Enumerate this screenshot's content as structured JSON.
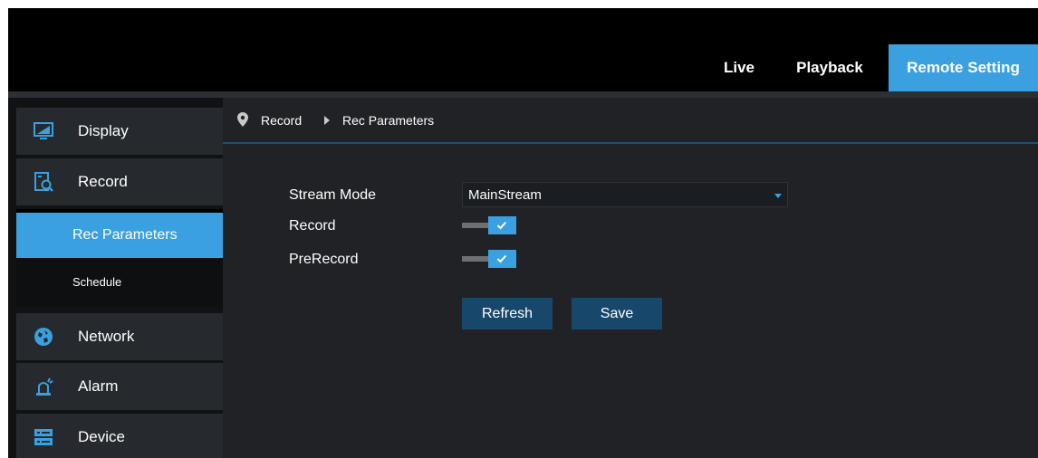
{
  "topnav": {
    "live": "Live",
    "playback": "Playback",
    "remote_setting": "Remote Setting",
    "active": "Remote Setting"
  },
  "sidebar": {
    "items": [
      {
        "label": "Display",
        "icon": "monitor-icon"
      },
      {
        "label": "Record",
        "icon": "record-search-icon"
      },
      {
        "label": "Network",
        "icon": "network-globe-icon"
      },
      {
        "label": "Alarm",
        "icon": "alarm-icon"
      },
      {
        "label": "Device",
        "icon": "device-storage-icon"
      }
    ],
    "record_submenu": [
      {
        "label": "Rec Parameters",
        "active": true
      },
      {
        "label": "Schedule",
        "active": false
      }
    ]
  },
  "breadcrumb": {
    "icon": "location-pin-icon",
    "section": "Record",
    "page": "Rec Parameters"
  },
  "form": {
    "stream_mode_label": "Stream Mode",
    "stream_mode_value": "MainStream",
    "record_label": "Record",
    "record_enabled": true,
    "prerecord_label": "PreRecord",
    "prerecord_enabled": true
  },
  "buttons": {
    "refresh": "Refresh",
    "save": "Save"
  },
  "colors": {
    "accent": "#3aa0e0",
    "button": "#17486b",
    "background": "#202226",
    "topbar": "#000000"
  }
}
